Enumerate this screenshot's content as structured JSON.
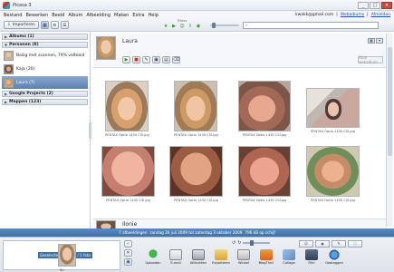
{
  "window": {
    "title": "Picasa 3",
    "controls": [
      "_",
      "□",
      "×"
    ]
  },
  "menu": [
    "Bestand",
    "Bewerken",
    "Beeld",
    "Album",
    "Afbeelding",
    "Maken",
    "Extra",
    "Help"
  ],
  "account": {
    "email": "kwakk@gmail.com",
    "links": [
      "Webalbums",
      "Afmelden"
    ],
    "separator": "|"
  },
  "toolbar": {
    "import_label": "Importeren",
    "filters_label": "Filters",
    "search_placeholder": ""
  },
  "sidebar": {
    "groups": [
      {
        "label": "Albums (1)",
        "expanded": false
      },
      {
        "label": "Personen (8)",
        "expanded": true
      },
      {
        "label": "Google Projects (2)",
        "expanded": false
      },
      {
        "label": "Mappen (123)",
        "expanded": false
      }
    ],
    "people": [
      {
        "label": "Bezig met scannen, 79% voltooid",
        "selected": false
      },
      {
        "label": "Kaja (20)",
        "selected": false
      },
      {
        "label": "Laura (7)",
        "selected": true
      }
    ]
  },
  "content": {
    "person_name": "Laura",
    "share_label": "Naar webalbum",
    "next_person": "Ilonie",
    "photos": [
      {
        "caption": "PENTAX Optio 1430 CSI.jpg"
      },
      {
        "caption": "PENTAX Optio 1430 CSI.jpg"
      },
      {
        "caption": "PENTAX Optio 1430 CSI.jpg"
      },
      {
        "caption": "PENTAX Optio 1430 CSI.jpg"
      },
      {
        "caption": "PENTAX Optio 1430 CSI.jpg"
      },
      {
        "caption": "PENTAX Optio 1430 CSI.jpg"
      },
      {
        "caption": "PENTAX Optio 1430 CSI.jpg"
      },
      {
        "caption": "PENTAX Optio 1430 CSI.jpg"
      }
    ]
  },
  "status": {
    "count": "7 afbeeldingen",
    "dates": "zondag 26 juli 2009 tot zaterdag 3 oktober 2009",
    "size": "796 kB op schijf"
  },
  "tray": {
    "selection_label": "Geselecteerd album / 1 foto",
    "thumb_caption": "Bic",
    "actions": [
      "Uploaden",
      "E-mail",
      "Afdrukken",
      "Exporteren",
      "Winkel",
      "BlogThis!",
      "Collage",
      "Film",
      "Geotaggen"
    ]
  },
  "colors": {
    "accent": "#3f70a6",
    "selection": "#5d81b3"
  }
}
